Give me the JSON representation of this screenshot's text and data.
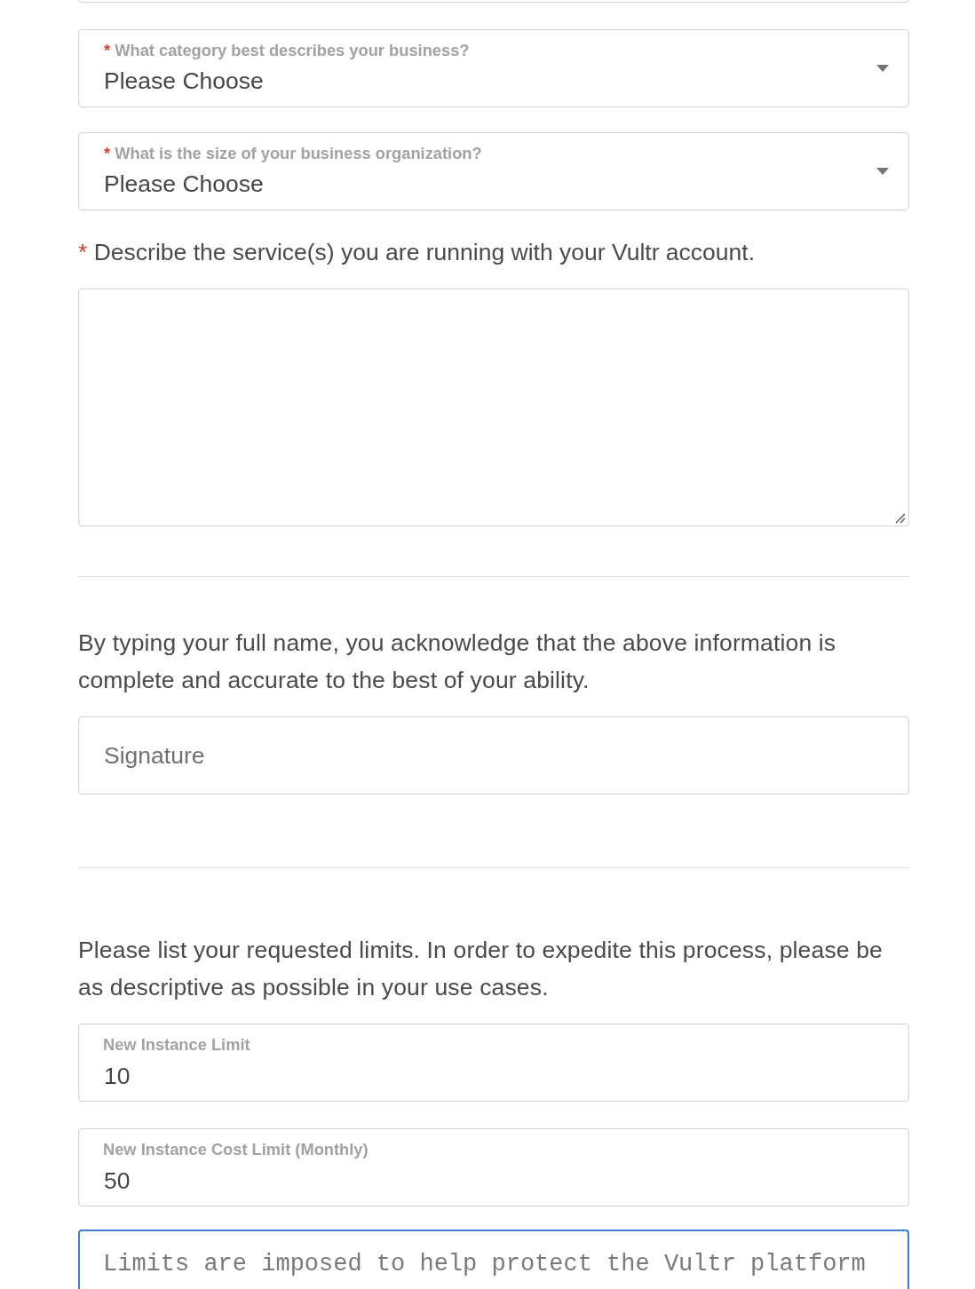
{
  "fields": [
    {
      "kind": "cut_off"
    },
    {
      "kind": "select",
      "required_mark": "*",
      "label": "What category best describes your business?",
      "value": "Please Choose"
    },
    {
      "kind": "select",
      "required_mark": "*",
      "label": "What is the size of your business organization?",
      "value": "Please Choose"
    },
    {
      "kind": "question",
      "required_mark": "*",
      "text": "Describe the service(s) you are running with your Vultr account."
    },
    {
      "kind": "textarea",
      "focused": false,
      "resize_handle": true
    },
    {
      "kind": "divider"
    },
    {
      "kind": "paragraph",
      "text": "By typing your full name, you acknowledge that the above information is complete and accurate to the best of your ability."
    },
    {
      "kind": "text_input",
      "placeholder": "Signature"
    },
    {
      "kind": "divider"
    },
    {
      "kind": "paragraph",
      "text": "Please list your requested limits. In order to expedite this process, please be as descriptive as possible in your use cases."
    },
    {
      "kind": "floating_input",
      "label": "New Instance Limit",
      "value": "10"
    },
    {
      "kind": "floating_input",
      "label": "New Instance Cost Limit (Monthly)",
      "value": "50"
    },
    {
      "kind": "textarea",
      "focused": true,
      "placeholder": "Limits are imposed to help protect the Vultr platform"
    }
  ]
}
